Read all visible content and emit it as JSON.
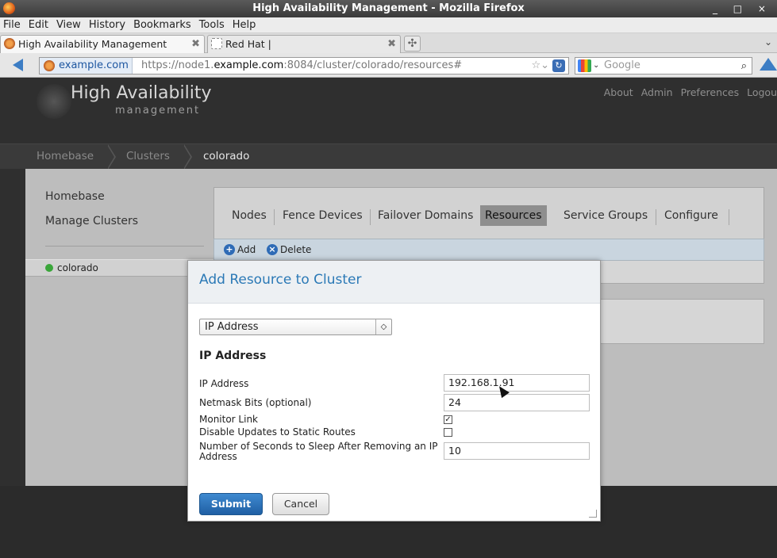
{
  "window": {
    "title": "High Availability Management - Mozilla Firefox",
    "controls": "_ □ ×"
  },
  "menu": [
    "File",
    "Edit",
    "View",
    "History",
    "Bookmarks",
    "Tools",
    "Help"
  ],
  "tabs": [
    {
      "label": "High Availability Management",
      "active": true
    },
    {
      "label": "Red Hat |",
      "active": false
    }
  ],
  "navbar": {
    "site": "example.com",
    "url_pre": "https://node1.",
    "url_host": "example.com",
    "url_post": ":8084/cluster/colorado/resources#",
    "search_placeholder": "Google"
  },
  "app": {
    "logo_title": "High Availability",
    "logo_sub": "management",
    "links": [
      "About",
      "Admin",
      "Preferences",
      "Logou"
    ]
  },
  "breadcrumb": [
    "Homebase",
    "Clusters",
    "colorado"
  ],
  "sidebar": {
    "homebase": "Homebase",
    "manage": "Manage Clusters",
    "cluster": "colorado"
  },
  "nav_tabs": [
    "Nodes",
    "Fence Devices",
    "Failover Domains",
    "Resources",
    "Service Groups",
    "Configure"
  ],
  "toolbar": {
    "add": "Add",
    "delete": "Delete"
  },
  "modal": {
    "title": "Add Resource to Cluster",
    "selected_type": "IP Address",
    "section_title": "IP Address",
    "fields": {
      "ip_label": "IP Address",
      "ip_value": "192.168.1.91",
      "netmask_label": "Netmask Bits (optional)",
      "netmask_value": "24",
      "monitor_label": "Monitor Link",
      "monitor_checked": true,
      "disable_label": "Disable Updates to Static Routes",
      "disable_checked": false,
      "sleep_label_1": "Number of Seconds to Sleep After Removing an IP",
      "sleep_label_2": "Address",
      "sleep_value": "10"
    },
    "submit": "Submit",
    "cancel": "Cancel"
  }
}
